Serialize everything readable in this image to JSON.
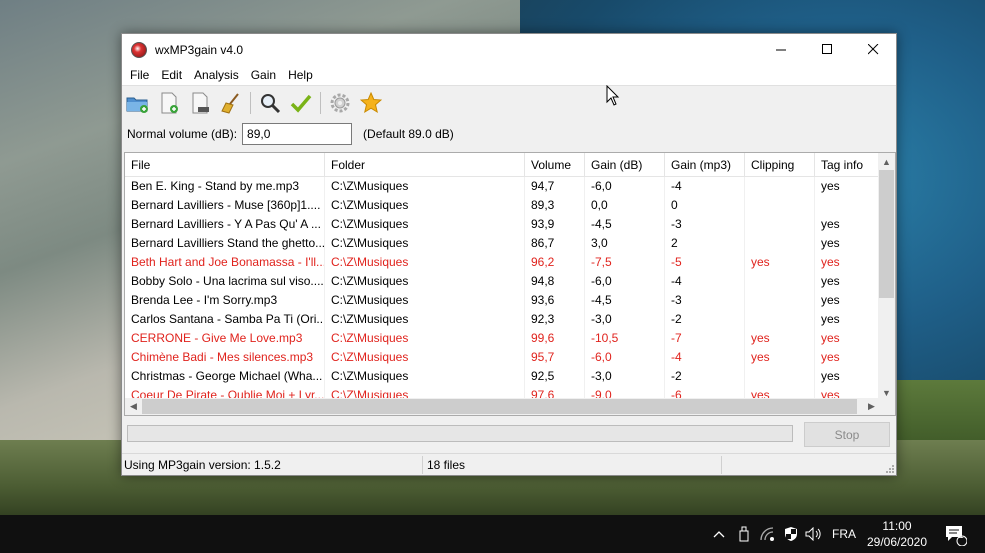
{
  "window": {
    "title": "wxMP3gain v4.0"
  },
  "menu": [
    "File",
    "Edit",
    "Analysis",
    "Gain",
    "Help"
  ],
  "toolbar": {
    "icons": [
      "add-folder-icon",
      "add-file-icon",
      "remove-file-icon",
      "clear-list-icon",
      "analyze-icon",
      "apply-gain-icon",
      "settings-icon",
      "favorite-icon"
    ]
  },
  "volume": {
    "label": "Normal volume (dB):",
    "value": "89,0",
    "default_text": "(Default 89.0 dB)"
  },
  "columns": [
    "File",
    "Folder",
    "Volume",
    "Gain (dB)",
    "Gain (mp3)",
    "Clipping",
    "Tag info"
  ],
  "rows": [
    {
      "file": "Ben E. King - Stand by me.mp3",
      "folder": "C:\\Z\\Musiques",
      "volume": "94,7",
      "gain_db": "-6,0",
      "gain_mp3": "-4",
      "clipping": "",
      "tag": "yes",
      "red": false
    },
    {
      "file": "Bernard Lavilliers - Muse [360p]1....",
      "folder": "C:\\Z\\Musiques",
      "volume": "89,3",
      "gain_db": "0,0",
      "gain_mp3": "0",
      "clipping": "",
      "tag": "",
      "red": false
    },
    {
      "file": "Bernard Lavilliers - Y A Pas Qu' A ...",
      "folder": "C:\\Z\\Musiques",
      "volume": "93,9",
      "gain_db": "-4,5",
      "gain_mp3": "-3",
      "clipping": "",
      "tag": "yes",
      "red": false
    },
    {
      "file": "Bernard Lavilliers Stand the ghetto...",
      "folder": "C:\\Z\\Musiques",
      "volume": "86,7",
      "gain_db": "3,0",
      "gain_mp3": "2",
      "clipping": "",
      "tag": "yes",
      "red": false
    },
    {
      "file": "Beth Hart and Joe Bonamassa - I'll...",
      "folder": "C:\\Z\\Musiques",
      "volume": "96,2",
      "gain_db": "-7,5",
      "gain_mp3": "-5",
      "clipping": "yes",
      "tag": "yes",
      "red": true
    },
    {
      "file": "Bobby Solo - Una lacrima sul viso....",
      "folder": "C:\\Z\\Musiques",
      "volume": "94,8",
      "gain_db": "-6,0",
      "gain_mp3": "-4",
      "clipping": "",
      "tag": "yes",
      "red": false
    },
    {
      "file": "Brenda Lee - I'm Sorry.mp3",
      "folder": "C:\\Z\\Musiques",
      "volume": "93,6",
      "gain_db": "-4,5",
      "gain_mp3": "-3",
      "clipping": "",
      "tag": "yes",
      "red": false
    },
    {
      "file": "Carlos Santana - Samba Pa Ti (Ori...",
      "folder": "C:\\Z\\Musiques",
      "volume": "92,3",
      "gain_db": "-3,0",
      "gain_mp3": "-2",
      "clipping": "",
      "tag": "yes",
      "red": false
    },
    {
      "file": "CERRONE - Give Me Love.mp3",
      "folder": "C:\\Z\\Musiques",
      "volume": "99,6",
      "gain_db": "-10,5",
      "gain_mp3": "-7",
      "clipping": "yes",
      "tag": "yes",
      "red": true
    },
    {
      "file": "Chimène Badi - Mes silences.mp3",
      "folder": "C:\\Z\\Musiques",
      "volume": "95,7",
      "gain_db": "-6,0",
      "gain_mp3": "-4",
      "clipping": "yes",
      "tag": "yes",
      "red": true
    },
    {
      "file": "Christmas - George Michael (Wha...",
      "folder": "C:\\Z\\Musiques",
      "volume": "92,5",
      "gain_db": "-3,0",
      "gain_mp3": "-2",
      "clipping": "",
      "tag": "yes",
      "red": false
    },
    {
      "file": "Coeur De Pirate - Oublie Moi + Lyr...",
      "folder": "C:\\Z\\Musiques",
      "volume": "97,6",
      "gain_db": "-9,0",
      "gain_mp3": "-6",
      "clipping": "yes",
      "tag": "yes",
      "red": true
    }
  ],
  "stop_label": "Stop",
  "progress": 0,
  "status": {
    "version": "Using MP3gain version: 1.5.2",
    "files": "18 files",
    "extra": ""
  },
  "taskbar": {
    "language": "FRA",
    "time": "11:00",
    "date": "29/06/2020",
    "notification_count": "1"
  },
  "colors": {
    "highlight_red": "#e0231d"
  }
}
